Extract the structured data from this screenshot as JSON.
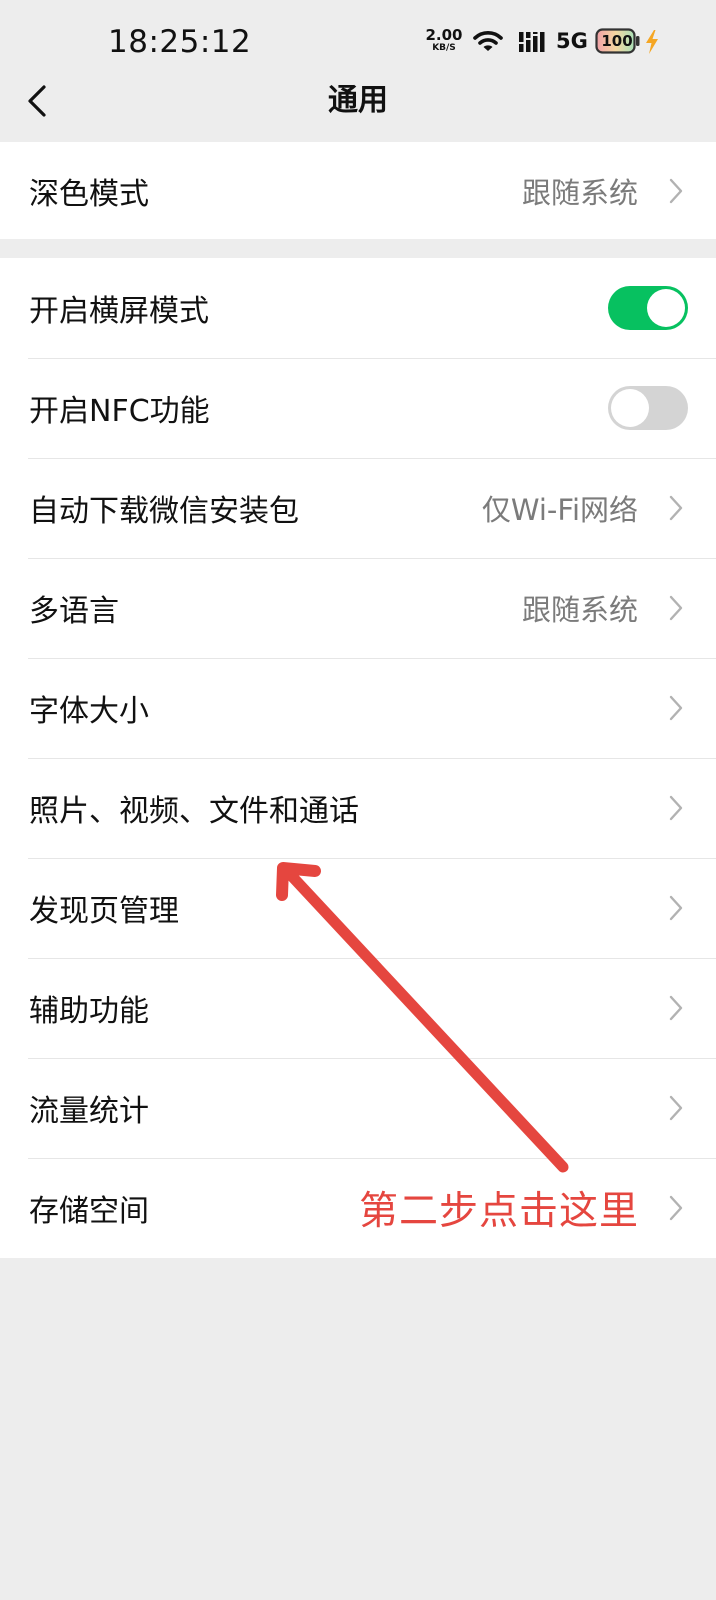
{
  "status_bar": {
    "time": "18:25:12",
    "net_speed_value": "2.00",
    "net_speed_unit": "KB/S",
    "network_type": "5G",
    "battery": "100",
    "icons": [
      "wifi-icon",
      "signal-icon",
      "battery-icon",
      "charging-icon"
    ]
  },
  "nav": {
    "back_icon": "chevron-left-icon",
    "title": "通用"
  },
  "section1": {
    "items": [
      {
        "label": "深色模式",
        "value": "跟随系统",
        "type": "link"
      }
    ]
  },
  "section2": {
    "items": [
      {
        "label": "开启横屏模式",
        "type": "toggle",
        "enabled": true
      },
      {
        "label": "开启NFC功能",
        "type": "toggle",
        "enabled": false
      },
      {
        "label": "自动下载微信安装包",
        "value": "仅Wi-Fi网络",
        "type": "link"
      },
      {
        "label": "多语言",
        "value": "跟随系统",
        "type": "link"
      },
      {
        "label": "字体大小",
        "type": "link"
      },
      {
        "label": "照片、视频、文件和通话",
        "type": "link"
      },
      {
        "label": "发现页管理",
        "type": "link"
      },
      {
        "label": "辅助功能",
        "type": "link"
      },
      {
        "label": "流量统计",
        "type": "link"
      },
      {
        "label": "存储空间",
        "type": "link"
      }
    ]
  },
  "annotation": {
    "text": "第二步点击这里",
    "color": "#e5463f"
  },
  "colors": {
    "accent_toggle_on": "#07c160",
    "toggle_off": "#d4d4d4",
    "background": "#ededed",
    "secondary_text": "#7b7b7b"
  }
}
